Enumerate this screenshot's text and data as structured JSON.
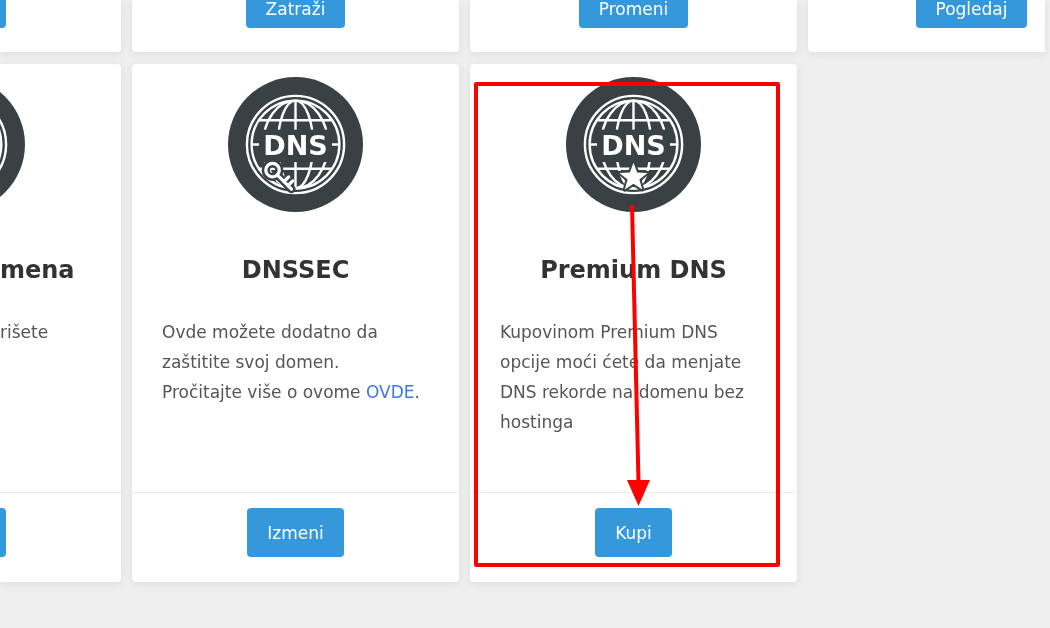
{
  "rows": [
    {
      "kind": "footer-only",
      "cards": [
        {
          "kind": "cut-left",
          "button": {
            "partial": true
          }
        },
        {
          "kind": "whole",
          "button": {
            "label": "Zatraži"
          }
        },
        {
          "kind": "whole",
          "button": {
            "label": "Promeni"
          }
        },
        {
          "kind": "cut-right",
          "button": {
            "label": "Pogledaj"
          }
        }
      ]
    },
    {
      "kind": "full",
      "cards": [
        {
          "kind": "cut-left",
          "icon": {
            "kind": "globe"
          },
          "title": "mena",
          "description": [
            "rišete"
          ],
          "button": {
            "partial": true
          },
          "highlighted": false
        },
        {
          "kind": "whole",
          "icon": {
            "kind": "key",
            "label": "DNS"
          },
          "title": "DNSSEC",
          "description": [
            "Ovde možete dodatno da zaštitite svoj domen.",
            "Pročitajte više o ovome"
          ],
          "link": {
            "label": "OVDE",
            "suffix": "."
          },
          "button": {
            "label": "Izmeni"
          },
          "highlighted": false
        },
        {
          "kind": "whole",
          "icon": {
            "kind": "star",
            "label": "DNS"
          },
          "title": "Premium DNS",
          "description": [
            "Kupovinom Premium DNS opcije moći ćete da menjate DNS rekorde na domenu bez hostinga"
          ],
          "button": {
            "label": "Kupi"
          },
          "highlighted": true
        }
      ]
    }
  ]
}
